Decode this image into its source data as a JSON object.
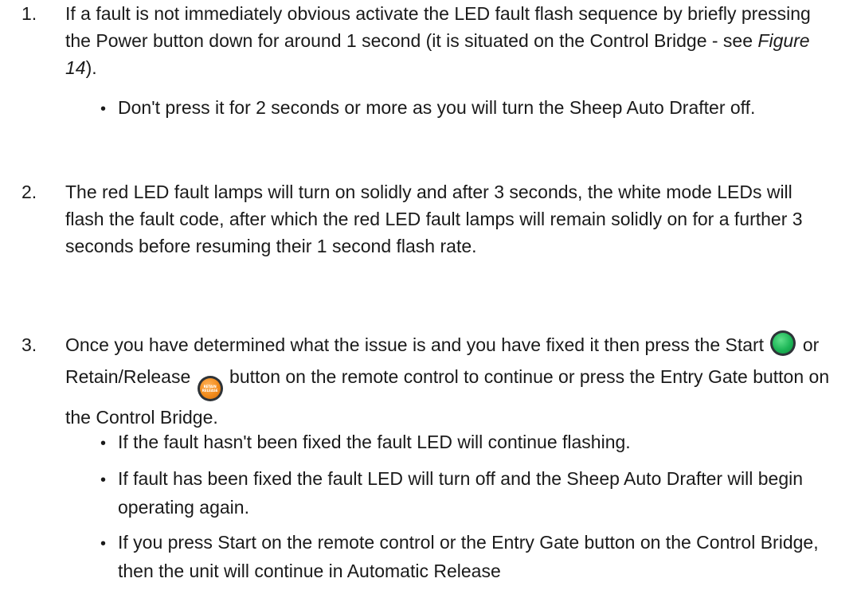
{
  "steps": [
    {
      "number": "1.",
      "text_before_ref": "If a fault is not immediately obvious activate the LED fault flash sequence by briefly pressing the Power button down for around 1 second (it is situated on the Control Bridge - see ",
      "ref": "Figure 14",
      "text_after_ref": ").",
      "bullets": [
        "Don't press it for 2 seconds or more as you will turn the Sheep Auto Drafter off."
      ]
    },
    {
      "number": "2.",
      "text": "The red LED fault lamps will turn on solidly and after 3 seconds, the white mode LEDs will flash the fault code, after which the red LED fault lamps will remain solidly on for a further 3 seconds before resuming their 1 second flash rate."
    },
    {
      "number": "3.",
      "text_part1": "Once you have determined what the issue is and you have fixed it then press the Start ",
      "text_part2": " or Retain/Release ",
      "text_part3": " button on the remote control to continue or press the Entry Gate button on the Control Bridge.",
      "bullets": [
        "If the fault hasn't been fixed the fault LED will continue flashing.",
        "If fault has been fixed the fault LED will turn off and the Sheep Auto Drafter will begin operating again.",
        "If you press Start on the remote control or the Entry Gate button on the Control Bridge, then the unit will continue in Automatic Release"
      ]
    }
  ],
  "icons": {
    "start_button_color": "#1db657",
    "retain_button_color": "#f28c1d",
    "retain_button_label_line1": "RETAIN",
    "retain_button_label_line2": "RELEASE"
  },
  "bullet_glyph": "•"
}
